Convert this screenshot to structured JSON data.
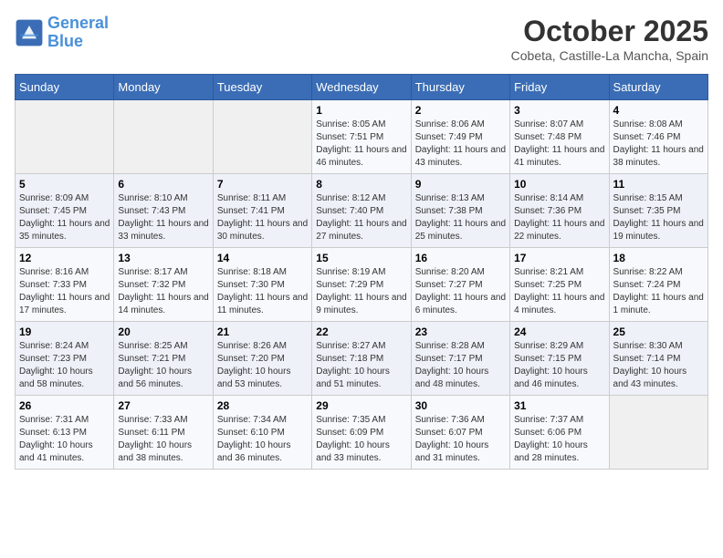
{
  "header": {
    "logo_line1": "General",
    "logo_line2": "Blue",
    "month": "October 2025",
    "location": "Cobeta, Castille-La Mancha, Spain"
  },
  "weekdays": [
    "Sunday",
    "Monday",
    "Tuesday",
    "Wednesday",
    "Thursday",
    "Friday",
    "Saturday"
  ],
  "weeks": [
    [
      {
        "day": "",
        "info": ""
      },
      {
        "day": "",
        "info": ""
      },
      {
        "day": "",
        "info": ""
      },
      {
        "day": "1",
        "info": "Sunrise: 8:05 AM\nSunset: 7:51 PM\nDaylight: 11 hours and 46 minutes."
      },
      {
        "day": "2",
        "info": "Sunrise: 8:06 AM\nSunset: 7:49 PM\nDaylight: 11 hours and 43 minutes."
      },
      {
        "day": "3",
        "info": "Sunrise: 8:07 AM\nSunset: 7:48 PM\nDaylight: 11 hours and 41 minutes."
      },
      {
        "day": "4",
        "info": "Sunrise: 8:08 AM\nSunset: 7:46 PM\nDaylight: 11 hours and 38 minutes."
      }
    ],
    [
      {
        "day": "5",
        "info": "Sunrise: 8:09 AM\nSunset: 7:45 PM\nDaylight: 11 hours and 35 minutes."
      },
      {
        "day": "6",
        "info": "Sunrise: 8:10 AM\nSunset: 7:43 PM\nDaylight: 11 hours and 33 minutes."
      },
      {
        "day": "7",
        "info": "Sunrise: 8:11 AM\nSunset: 7:41 PM\nDaylight: 11 hours and 30 minutes."
      },
      {
        "day": "8",
        "info": "Sunrise: 8:12 AM\nSunset: 7:40 PM\nDaylight: 11 hours and 27 minutes."
      },
      {
        "day": "9",
        "info": "Sunrise: 8:13 AM\nSunset: 7:38 PM\nDaylight: 11 hours and 25 minutes."
      },
      {
        "day": "10",
        "info": "Sunrise: 8:14 AM\nSunset: 7:36 PM\nDaylight: 11 hours and 22 minutes."
      },
      {
        "day": "11",
        "info": "Sunrise: 8:15 AM\nSunset: 7:35 PM\nDaylight: 11 hours and 19 minutes."
      }
    ],
    [
      {
        "day": "12",
        "info": "Sunrise: 8:16 AM\nSunset: 7:33 PM\nDaylight: 11 hours and 17 minutes."
      },
      {
        "day": "13",
        "info": "Sunrise: 8:17 AM\nSunset: 7:32 PM\nDaylight: 11 hours and 14 minutes."
      },
      {
        "day": "14",
        "info": "Sunrise: 8:18 AM\nSunset: 7:30 PM\nDaylight: 11 hours and 11 minutes."
      },
      {
        "day": "15",
        "info": "Sunrise: 8:19 AM\nSunset: 7:29 PM\nDaylight: 11 hours and 9 minutes."
      },
      {
        "day": "16",
        "info": "Sunrise: 8:20 AM\nSunset: 7:27 PM\nDaylight: 11 hours and 6 minutes."
      },
      {
        "day": "17",
        "info": "Sunrise: 8:21 AM\nSunset: 7:25 PM\nDaylight: 11 hours and 4 minutes."
      },
      {
        "day": "18",
        "info": "Sunrise: 8:22 AM\nSunset: 7:24 PM\nDaylight: 11 hours and 1 minute."
      }
    ],
    [
      {
        "day": "19",
        "info": "Sunrise: 8:24 AM\nSunset: 7:23 PM\nDaylight: 10 hours and 58 minutes."
      },
      {
        "day": "20",
        "info": "Sunrise: 8:25 AM\nSunset: 7:21 PM\nDaylight: 10 hours and 56 minutes."
      },
      {
        "day": "21",
        "info": "Sunrise: 8:26 AM\nSunset: 7:20 PM\nDaylight: 10 hours and 53 minutes."
      },
      {
        "day": "22",
        "info": "Sunrise: 8:27 AM\nSunset: 7:18 PM\nDaylight: 10 hours and 51 minutes."
      },
      {
        "day": "23",
        "info": "Sunrise: 8:28 AM\nSunset: 7:17 PM\nDaylight: 10 hours and 48 minutes."
      },
      {
        "day": "24",
        "info": "Sunrise: 8:29 AM\nSunset: 7:15 PM\nDaylight: 10 hours and 46 minutes."
      },
      {
        "day": "25",
        "info": "Sunrise: 8:30 AM\nSunset: 7:14 PM\nDaylight: 10 hours and 43 minutes."
      }
    ],
    [
      {
        "day": "26",
        "info": "Sunrise: 7:31 AM\nSunset: 6:13 PM\nDaylight: 10 hours and 41 minutes."
      },
      {
        "day": "27",
        "info": "Sunrise: 7:33 AM\nSunset: 6:11 PM\nDaylight: 10 hours and 38 minutes."
      },
      {
        "day": "28",
        "info": "Sunrise: 7:34 AM\nSunset: 6:10 PM\nDaylight: 10 hours and 36 minutes."
      },
      {
        "day": "29",
        "info": "Sunrise: 7:35 AM\nSunset: 6:09 PM\nDaylight: 10 hours and 33 minutes."
      },
      {
        "day": "30",
        "info": "Sunrise: 7:36 AM\nSunset: 6:07 PM\nDaylight: 10 hours and 31 minutes."
      },
      {
        "day": "31",
        "info": "Sunrise: 7:37 AM\nSunset: 6:06 PM\nDaylight: 10 hours and 28 minutes."
      },
      {
        "day": "",
        "info": ""
      }
    ]
  ]
}
